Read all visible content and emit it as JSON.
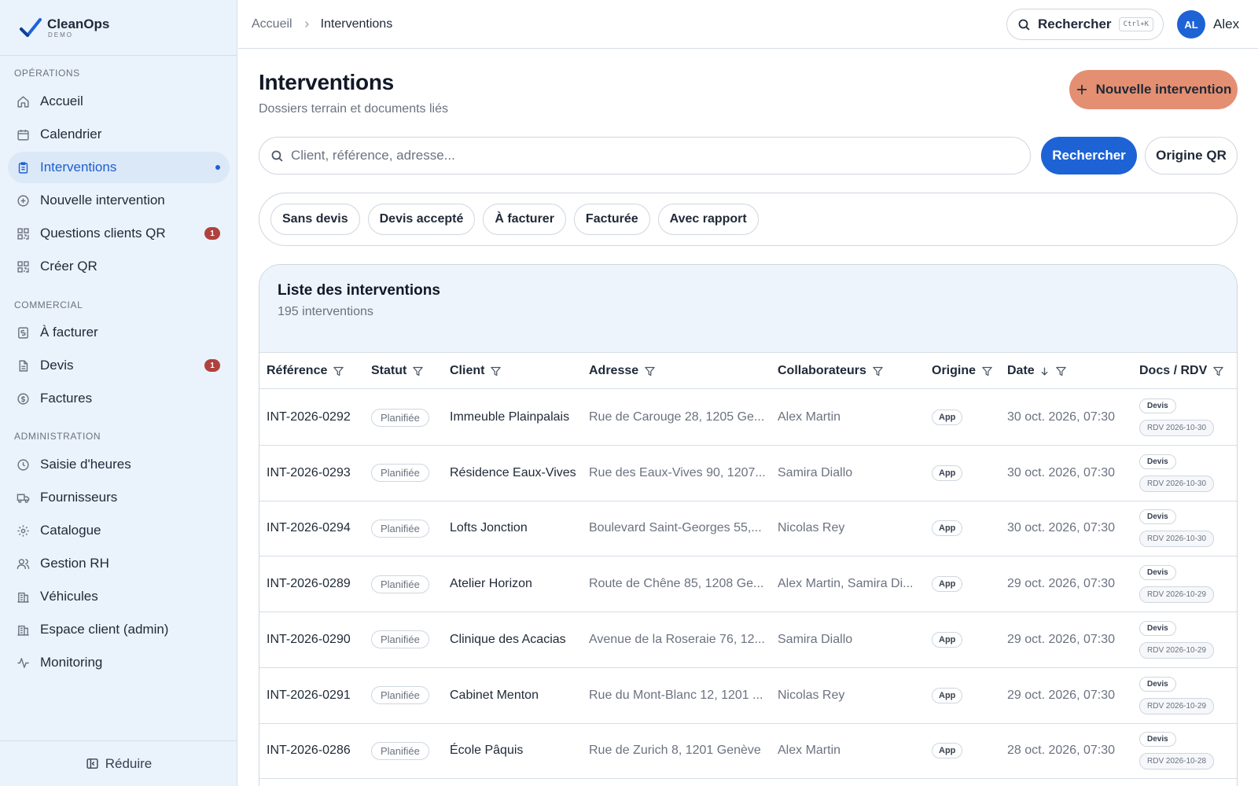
{
  "brand": {
    "name": "CleanOps",
    "sub": "DEMO"
  },
  "sidebar": {
    "sections": [
      {
        "label": "OPÉRATIONS"
      },
      {
        "label": "COMMERCIAL"
      },
      {
        "label": "ADMINISTRATION"
      }
    ],
    "items": [
      {
        "label": "Accueil",
        "icon": "home-icon"
      },
      {
        "label": "Calendrier",
        "icon": "calendar-icon"
      },
      {
        "label": "Interventions",
        "icon": "clipboard-icon",
        "active": true
      },
      {
        "label": "Nouvelle intervention",
        "icon": "plus-circle-icon"
      },
      {
        "label": "Questions clients QR",
        "icon": "qr-icon",
        "badge": "1"
      },
      {
        "label": "Créer QR",
        "icon": "qr-icon"
      },
      {
        "label": "À facturer",
        "icon": "invoice-icon"
      },
      {
        "label": "Devis",
        "icon": "document-icon",
        "badge": "1"
      },
      {
        "label": "Factures",
        "icon": "dollar-circle-icon"
      },
      {
        "label": "Saisie d'heures",
        "icon": "clock-icon"
      },
      {
        "label": "Fournisseurs",
        "icon": "truck-icon"
      },
      {
        "label": "Catalogue",
        "icon": "gear-icon"
      },
      {
        "label": "Gestion RH",
        "icon": "users-icon"
      },
      {
        "label": "Véhicules",
        "icon": "building-icon"
      },
      {
        "label": "Espace client (admin)",
        "icon": "building-icon"
      },
      {
        "label": "Monitoring",
        "icon": "activity-icon"
      }
    ],
    "collapse_label": "Réduire"
  },
  "topbar": {
    "breadcrumb": {
      "home": "Accueil",
      "current": "Interventions"
    },
    "search_label": "Rechercher",
    "shortcut": "Ctrl+K",
    "avatar_initials": "AL",
    "user_name": "Alex"
  },
  "page": {
    "title": "Interventions",
    "subtitle": "Dossiers terrain et documents liés",
    "new_button": "Nouvelle intervention",
    "search_placeholder": "Client, référence, adresse...",
    "search_button": "Rechercher",
    "origin_button": "Origine QR",
    "filters": [
      "Sans devis",
      "Devis accepté",
      "À facturer",
      "Facturée",
      "Avec rapport"
    ]
  },
  "list": {
    "title": "Liste des interventions",
    "count": "195 interventions",
    "columns": {
      "reference": "Référence",
      "status": "Statut",
      "client": "Client",
      "address": "Adresse",
      "collaborators": "Collaborateurs",
      "origin": "Origine",
      "date": "Date",
      "docs": "Docs / RDV"
    },
    "rows": [
      {
        "ref": "INT-2026-0292",
        "status": "Planifiée",
        "client": "Immeuble Plainpalais",
        "address": "Rue de Carouge 28, 1205 Ge...",
        "collab": "Alex Martin",
        "origin": "App",
        "date": "30 oct. 2026, 07:30",
        "doc": "Devis",
        "rdv": "RDV 2026-10-30"
      },
      {
        "ref": "INT-2026-0293",
        "status": "Planifiée",
        "client": "Résidence Eaux-Vives",
        "address": "Rue des Eaux-Vives 90, 1207...",
        "collab": "Samira Diallo",
        "origin": "App",
        "date": "30 oct. 2026, 07:30",
        "doc": "Devis",
        "rdv": "RDV 2026-10-30"
      },
      {
        "ref": "INT-2026-0294",
        "status": "Planifiée",
        "client": "Lofts Jonction",
        "address": "Boulevard Saint-Georges 55,...",
        "collab": "Nicolas Rey",
        "origin": "App",
        "date": "30 oct. 2026, 07:30",
        "doc": "Devis",
        "rdv": "RDV 2026-10-30"
      },
      {
        "ref": "INT-2026-0289",
        "status": "Planifiée",
        "client": "Atelier Horizon",
        "address": "Route de Chêne 85, 1208 Ge...",
        "collab": "Alex Martin, Samira Di...",
        "origin": "App",
        "date": "29 oct. 2026, 07:30",
        "doc": "Devis",
        "rdv": "RDV 2026-10-29"
      },
      {
        "ref": "INT-2026-0290",
        "status": "Planifiée",
        "client": "Clinique des Acacias",
        "address": "Avenue de la Roseraie 76, 12...",
        "collab": "Samira Diallo",
        "origin": "App",
        "date": "29 oct. 2026, 07:30",
        "doc": "Devis",
        "rdv": "RDV 2026-10-29"
      },
      {
        "ref": "INT-2026-0291",
        "status": "Planifiée",
        "client": "Cabinet Menton",
        "address": "Rue du Mont-Blanc 12, 1201 ...",
        "collab": "Nicolas Rey",
        "origin": "App",
        "date": "29 oct. 2026, 07:30",
        "doc": "Devis",
        "rdv": "RDV 2026-10-29"
      },
      {
        "ref": "INT-2026-0286",
        "status": "Planifiée",
        "client": "École Pâquis",
        "address": "Rue de Zurich 8, 1201 Genève",
        "collab": "Alex Martin",
        "origin": "App",
        "date": "28 oct. 2026, 07:30",
        "doc": "Devis",
        "rdv": "RDV 2026-10-28"
      }
    ]
  },
  "colors": {
    "accent": "#1d63d6",
    "cta": "#e48f72",
    "badge": "#b0413e",
    "sidebar_bg": "#eaf2fb"
  }
}
